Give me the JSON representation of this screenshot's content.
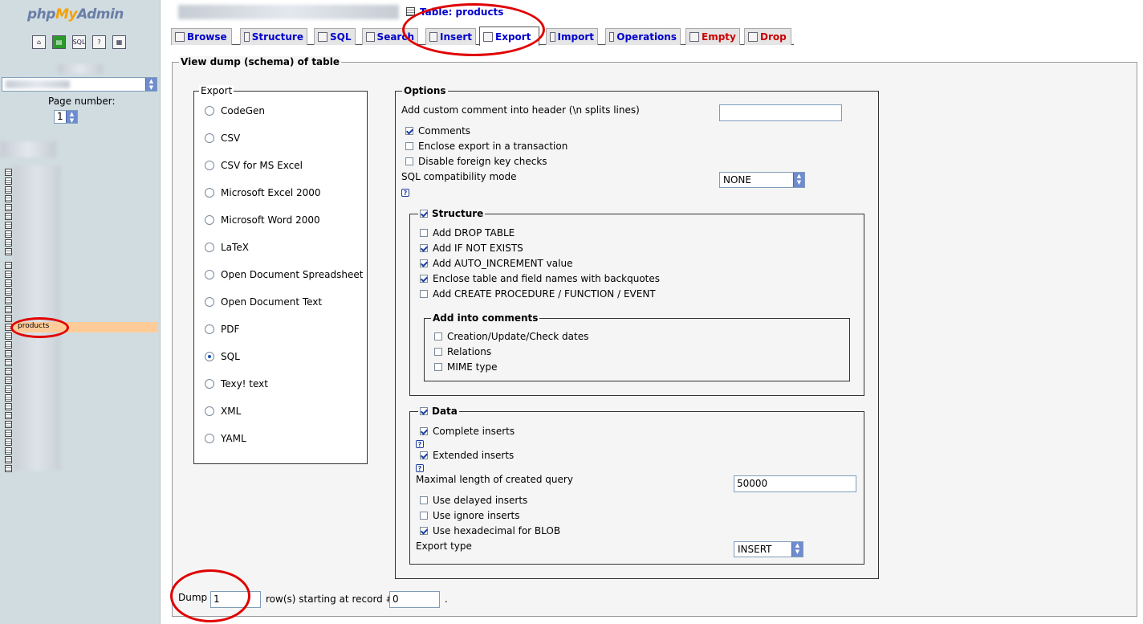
{
  "app": {
    "logo": {
      "php": "php",
      "my": "My",
      "admin": "Admin"
    }
  },
  "nav": {
    "icons": [
      "home-icon",
      "query-window-icon",
      "sql-icon",
      "help-icon",
      "docs-icon"
    ],
    "page_number_label": "Page number:",
    "page_number_value": "1",
    "selected_table": "products"
  },
  "header": {
    "table_title": "Table: products"
  },
  "tabs": [
    {
      "label": "Browse"
    },
    {
      "label": "Structure"
    },
    {
      "label": "SQL"
    },
    {
      "label": "Search"
    },
    {
      "label": "Insert"
    },
    {
      "label": "Export",
      "active": true
    },
    {
      "label": "Import"
    },
    {
      "label": "Operations"
    },
    {
      "label": "Empty"
    },
    {
      "label": "Drop"
    }
  ],
  "main": {
    "legend": "View dump (schema) of table"
  },
  "export": {
    "legend": "Export",
    "formats": [
      {
        "label": "CodeGen",
        "checked": false
      },
      {
        "label": "CSV",
        "checked": false
      },
      {
        "label": "CSV for MS Excel",
        "checked": false
      },
      {
        "label": "Microsoft Excel 2000",
        "checked": false
      },
      {
        "label": "Microsoft Word 2000",
        "checked": false
      },
      {
        "label": "LaTeX",
        "checked": false
      },
      {
        "label": "Open Document Spreadsheet",
        "checked": false
      },
      {
        "label": "Open Document Text",
        "checked": false
      },
      {
        "label": "PDF",
        "checked": false
      },
      {
        "label": "SQL",
        "checked": true
      },
      {
        "label": "Texy! text",
        "checked": false
      },
      {
        "label": "XML",
        "checked": false
      },
      {
        "label": "YAML",
        "checked": false
      }
    ]
  },
  "options": {
    "legend": "Options",
    "custom_comment_label": "Add custom comment into header (\\n splits lines)",
    "custom_comment_value": "",
    "comments": {
      "label": "Comments",
      "checked": true
    },
    "transaction": {
      "label": "Enclose export in a transaction",
      "checked": false
    },
    "foreign_keys": {
      "label": "Disable foreign key checks",
      "checked": false
    },
    "compat_label": "SQL compatibility mode",
    "compat_value": "NONE",
    "structure": {
      "legend": "Structure",
      "checked": true,
      "items": [
        {
          "label": "Add DROP TABLE",
          "checked": false
        },
        {
          "label": "Add IF NOT EXISTS",
          "checked": true
        },
        {
          "label": "Add AUTO_INCREMENT value",
          "checked": true
        },
        {
          "label": "Enclose table and field names with backquotes",
          "checked": true
        },
        {
          "label": "Add CREATE PROCEDURE / FUNCTION / EVENT",
          "checked": false
        }
      ],
      "comments_legend": "Add into comments",
      "comments_items": [
        {
          "label": "Creation/Update/Check dates",
          "checked": false
        },
        {
          "label": "Relations",
          "checked": false
        },
        {
          "label": "MIME type",
          "checked": false
        }
      ]
    },
    "data": {
      "legend": "Data",
      "checked": true,
      "complete_inserts": {
        "label": "Complete inserts",
        "checked": true
      },
      "extended_inserts": {
        "label": "Extended inserts",
        "checked": true
      },
      "max_query_label": "Maximal length of created query",
      "max_query_value": "50000",
      "delayed": {
        "label": "Use delayed inserts",
        "checked": false
      },
      "ignore": {
        "label": "Use ignore inserts",
        "checked": false
      },
      "hex_blob": {
        "label": "Use hexadecimal for BLOB",
        "checked": true
      },
      "export_type_label": "Export type",
      "export_type_value": "INSERT"
    }
  },
  "dump": {
    "prefix": "Dump",
    "rows_value": "1",
    "middle": "row(s) starting at record #",
    "start_value": "0",
    "suffix": "."
  },
  "colors": {
    "link": "#0000cc",
    "danger": "#cc0000",
    "highlight": "#e00000",
    "nav_bg": "#d0dce0"
  }
}
